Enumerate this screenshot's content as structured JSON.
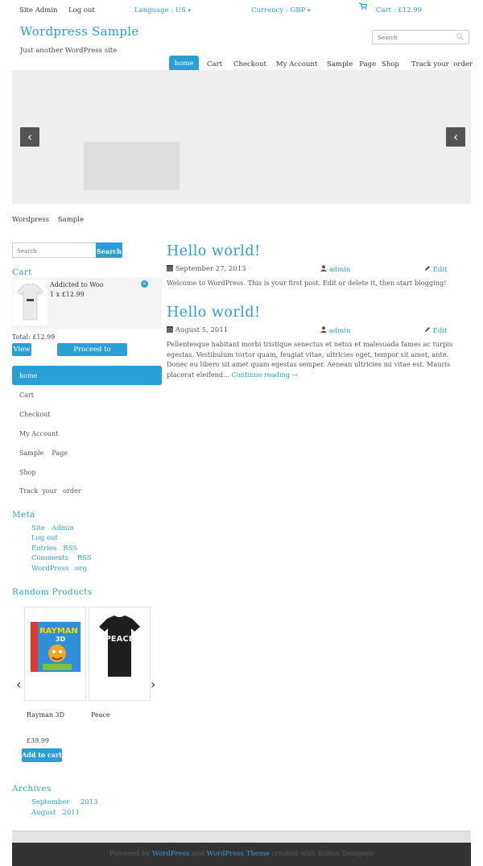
{
  "topbar": {
    "site_admin": "Site  Admin",
    "log_out": "Log out",
    "language": "Language  : US",
    "currency": "Currency  : GBP",
    "cart": "Cart : £12.99"
  },
  "site": {
    "title": "Wordpress Sample",
    "tagline": "Just another WordPress site"
  },
  "search_top": {
    "placeholder": "Search"
  },
  "nav": {
    "items": [
      "home",
      "Cart",
      "Checkout",
      "My Account",
      "Sample   Page",
      "Shop",
      "Track your  order"
    ],
    "active_index": 0
  },
  "breadcrumb": "Wordpress    Sample",
  "sidebar": {
    "search_placeholder": "Search",
    "search_button": "Search",
    "cart_title": "Cart",
    "cart_item": {
      "name": "Addicted to Woo",
      "qty_price": "1 x £12.99"
    },
    "cart_total": "Total: £12.99",
    "view_button": "View",
    "checkout_button": "Proceed to Checkout",
    "menu": [
      "home",
      "Cart",
      "Checkout",
      "My Account",
      "Sample    Page",
      "Shop",
      "Track  your   order"
    ],
    "meta_title": "Meta",
    "meta_links": [
      "Site   Admin",
      "Log out",
      "Entries   RSS",
      "Comments    RSS",
      "WordPress  .org"
    ],
    "random_title": "Random Products",
    "products": [
      {
        "name": "Rayman 3D",
        "price": "£39.99"
      },
      {
        "name": "Peace",
        "price": ""
      }
    ],
    "add_to_cart": "Add to cart",
    "archives_title": "Archives",
    "archives": [
      "September     2013",
      "August   2011"
    ]
  },
  "posts": [
    {
      "title": "Hello world!",
      "date": "September 27, 2013",
      "author": "admin",
      "edit": "Edit",
      "body": "Welcome to WordPress. This is your first post. Edit or delete it, then start blogging!",
      "more": ""
    },
    {
      "title": "Hello world!",
      "date": "August 5, 2011",
      "author": "admin",
      "edit": "Edit",
      "body": "Pellentesque habitant morbi tristique senectus et netus et malesuada fames ac turpis egestas. Vestibulum tortor quam, feugiat vitae, ultricies eget, tempor sit amet, ante. Donec eu libero sit amet quam egestas semper. Aenean ultricies mi vitae est. Mauris placerat eleifend...",
      "more": "Continue reading →"
    }
  ],
  "footer": {
    "powered_by": "Powered by",
    "wordpress": "WordPress",
    "and": "and",
    "theme": "WordPress Theme",
    "created_with": "created with Billion Designer"
  },
  "colors": {
    "accent": "#2a9fd6",
    "footer": "#333333",
    "slider_bg": "#eeeeee"
  },
  "icons": [
    "cart-icon",
    "search-icon",
    "caret-down-icon",
    "chevron-left-icon",
    "calendar-icon",
    "user-icon",
    "pencil-icon",
    "remove-icon"
  ]
}
